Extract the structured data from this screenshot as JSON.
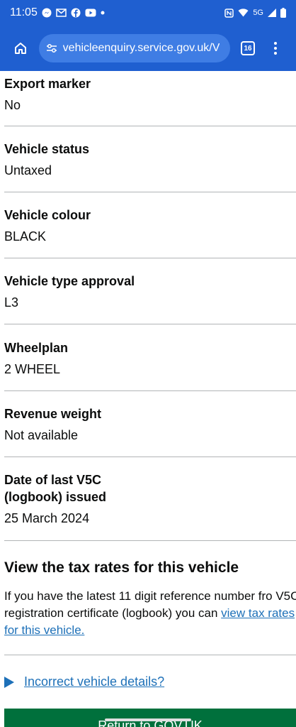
{
  "status_bar": {
    "time": "11:05",
    "network": "5G",
    "icons": [
      "messenger-icon",
      "gmail-icon",
      "facebook-icon",
      "youtube-icon",
      "nfc-icon",
      "wifi-icon",
      "signal-icon",
      "battery-icon"
    ]
  },
  "browser": {
    "url": "vehicleenquiry.service.gov.uk/V",
    "tab_count": "16"
  },
  "vehicle_details": [
    {
      "label": "Export marker",
      "value": "No"
    },
    {
      "label": "Vehicle status",
      "value": "Untaxed"
    },
    {
      "label": "Vehicle colour",
      "value": "BLACK"
    },
    {
      "label": "Vehicle type approval",
      "value": "L3"
    },
    {
      "label": "Wheelplan",
      "value": "2 WHEEL"
    },
    {
      "label": "Revenue weight",
      "value": "Not available"
    },
    {
      "label_line1": "Date of last V5C",
      "label_line2": "(logbook) issued",
      "value": "25 March 2024"
    }
  ],
  "tax_rates": {
    "heading": "View the tax rates for this vehicle",
    "text_before": "If you have the latest 11 digit reference number fro V5C registration certificate (logbook) you can ",
    "link_text": "view tax rates for this vehicle."
  },
  "details": {
    "label": "Incorrect vehicle details?"
  },
  "return_button": {
    "label": "Return to GOV.UK"
  },
  "colors": {
    "chrome": "#1f5fd0",
    "link": "#1d70b8",
    "button": "#00703c"
  }
}
